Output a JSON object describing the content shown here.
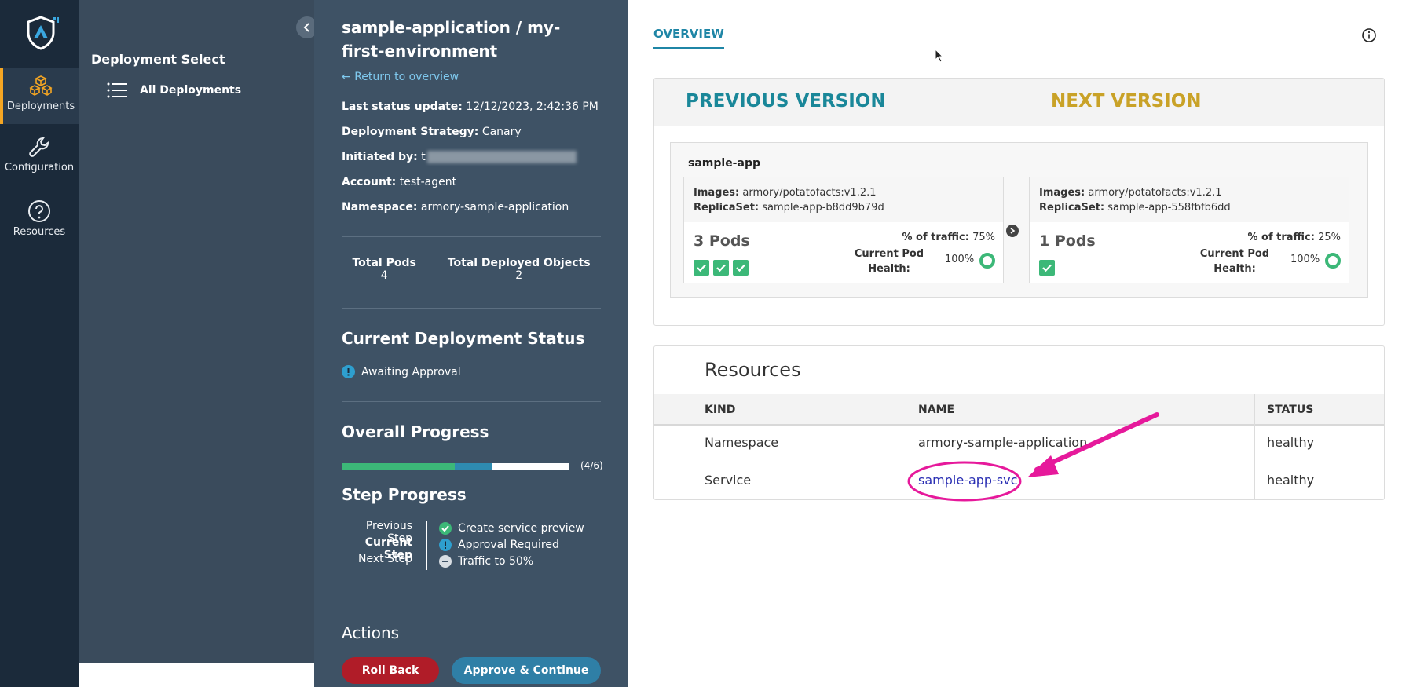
{
  "nav": {
    "items": [
      {
        "label": "Deployments",
        "icon": "boxes-icon",
        "active": true
      },
      {
        "label": "Configuration",
        "icon": "wrench-icon",
        "active": false
      },
      {
        "label": "Resources",
        "icon": "help-circle-icon",
        "active": false
      }
    ]
  },
  "select_panel": {
    "title": "Deployment Select",
    "item_label": "All Deployments"
  },
  "details": {
    "title": "sample-application / my-first-environment",
    "return_link": "Return to overview",
    "last_status_label": "Last status update:",
    "last_status_value": "12/12/2023, 2:42:36 PM",
    "strategy_label": "Deployment Strategy:",
    "strategy_value": "Canary",
    "initiated_label": "Initiated by:",
    "initiated_value": "t",
    "account_label": "Account:",
    "account_value": "test-agent",
    "namespace_label": "Namespace:",
    "namespace_value": "armory-sample-application",
    "total_pods_label": "Total Pods",
    "total_pods_value": "4",
    "total_objects_label": "Total Deployed Objects",
    "total_objects_value": "2",
    "current_status_heading": "Current Deployment Status",
    "current_status_value": "Awaiting Approval",
    "overall_progress_heading": "Overall Progress",
    "progress_count": "(4/6)",
    "progress": {
      "completed": 3,
      "in_progress": 1,
      "total": 6
    },
    "step_progress_heading": "Step Progress",
    "steps": {
      "previous_label": "Previous Step",
      "current_label": "Current Step",
      "next_label": "Next Step",
      "previous_value": "Create service preview",
      "current_value": "Approval Required",
      "next_value": "Traffic to 50%"
    },
    "actions_heading": "Actions",
    "rollback_label": "Roll Back",
    "approve_label": "Approve & Continue"
  },
  "main": {
    "tab_label": "OVERVIEW",
    "versions": {
      "previous_heading": "PREVIOUS VERSION",
      "next_heading": "NEXT VERSION",
      "app_name": "sample-app",
      "previous": {
        "images_label": "Images:",
        "images_value": "armory/potatofacts:v1.2.1",
        "replicaset_label": "ReplicaSet:",
        "replicaset_value": "sample-app-b8dd9b79d",
        "pods": "3 Pods",
        "pod_count": 3,
        "traffic_label": "% of traffic:",
        "traffic_value": "75%",
        "health_label": "Current Pod Health:",
        "health_value": "100%"
      },
      "next": {
        "images_label": "Images:",
        "images_value": "armory/potatofacts:v1.2.1",
        "replicaset_label": "ReplicaSet:",
        "replicaset_value": "sample-app-558fbfb6dd",
        "pods": "1 Pods",
        "pod_count": 1,
        "traffic_label": "% of traffic:",
        "traffic_value": "25%",
        "health_label": "Current Pod Health:",
        "health_value": "100%"
      }
    },
    "resources": {
      "title": "Resources",
      "columns": [
        "KIND",
        "NAME",
        "STATUS"
      ],
      "rows": [
        {
          "kind": "Namespace",
          "name": "armory-sample-application",
          "status": "healthy"
        },
        {
          "kind": "Service",
          "name": "sample-app-svc",
          "status": "healthy"
        }
      ]
    }
  },
  "colors": {
    "rail_bg": "#1b2a3a",
    "details_bg": "#3e5265",
    "accent_teal": "#1a8799",
    "accent_gold": "#c9a227",
    "success": "#3cb878",
    "danger": "#b01c28",
    "annotation": "#e6199b"
  }
}
